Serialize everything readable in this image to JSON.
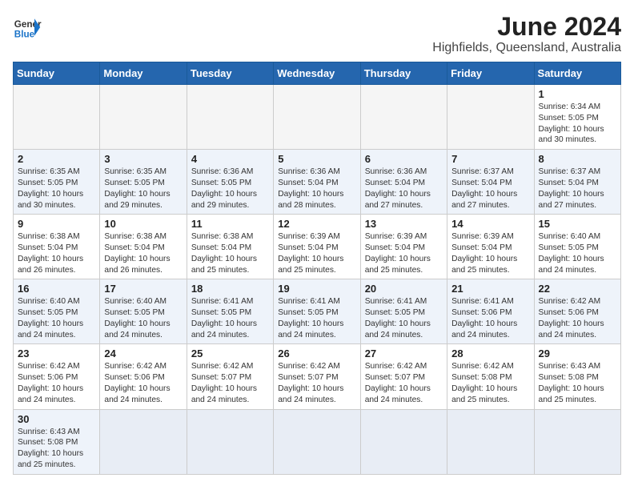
{
  "header": {
    "logo_general": "General",
    "logo_blue": "Blue",
    "month_title": "June 2024",
    "location": "Highfields, Queensland, Australia"
  },
  "weekdays": [
    "Sunday",
    "Monday",
    "Tuesday",
    "Wednesday",
    "Thursday",
    "Friday",
    "Saturday"
  ],
  "weeks": [
    [
      {
        "day": "",
        "info": "",
        "empty": true
      },
      {
        "day": "",
        "info": "",
        "empty": true
      },
      {
        "day": "",
        "info": "",
        "empty": true
      },
      {
        "day": "",
        "info": "",
        "empty": true
      },
      {
        "day": "",
        "info": "",
        "empty": true
      },
      {
        "day": "",
        "info": "",
        "empty": true
      },
      {
        "day": "1",
        "info": "Sunrise: 6:34 AM\nSunset: 5:05 PM\nDaylight: 10 hours\nand 30 minutes."
      }
    ],
    [
      {
        "day": "2",
        "info": "Sunrise: 6:35 AM\nSunset: 5:05 PM\nDaylight: 10 hours\nand 30 minutes."
      },
      {
        "day": "3",
        "info": "Sunrise: 6:35 AM\nSunset: 5:05 PM\nDaylight: 10 hours\nand 29 minutes."
      },
      {
        "day": "4",
        "info": "Sunrise: 6:36 AM\nSunset: 5:05 PM\nDaylight: 10 hours\nand 29 minutes."
      },
      {
        "day": "5",
        "info": "Sunrise: 6:36 AM\nSunset: 5:04 PM\nDaylight: 10 hours\nand 28 minutes."
      },
      {
        "day": "6",
        "info": "Sunrise: 6:36 AM\nSunset: 5:04 PM\nDaylight: 10 hours\nand 27 minutes."
      },
      {
        "day": "7",
        "info": "Sunrise: 6:37 AM\nSunset: 5:04 PM\nDaylight: 10 hours\nand 27 minutes."
      },
      {
        "day": "8",
        "info": "Sunrise: 6:37 AM\nSunset: 5:04 PM\nDaylight: 10 hours\nand 27 minutes."
      }
    ],
    [
      {
        "day": "9",
        "info": "Sunrise: 6:38 AM\nSunset: 5:04 PM\nDaylight: 10 hours\nand 26 minutes."
      },
      {
        "day": "10",
        "info": "Sunrise: 6:38 AM\nSunset: 5:04 PM\nDaylight: 10 hours\nand 26 minutes."
      },
      {
        "day": "11",
        "info": "Sunrise: 6:38 AM\nSunset: 5:04 PM\nDaylight: 10 hours\nand 25 minutes."
      },
      {
        "day": "12",
        "info": "Sunrise: 6:39 AM\nSunset: 5:04 PM\nDaylight: 10 hours\nand 25 minutes."
      },
      {
        "day": "13",
        "info": "Sunrise: 6:39 AM\nSunset: 5:04 PM\nDaylight: 10 hours\nand 25 minutes."
      },
      {
        "day": "14",
        "info": "Sunrise: 6:39 AM\nSunset: 5:04 PM\nDaylight: 10 hours\nand 25 minutes."
      },
      {
        "day": "15",
        "info": "Sunrise: 6:40 AM\nSunset: 5:05 PM\nDaylight: 10 hours\nand 24 minutes."
      }
    ],
    [
      {
        "day": "16",
        "info": "Sunrise: 6:40 AM\nSunset: 5:05 PM\nDaylight: 10 hours\nand 24 minutes."
      },
      {
        "day": "17",
        "info": "Sunrise: 6:40 AM\nSunset: 5:05 PM\nDaylight: 10 hours\nand 24 minutes."
      },
      {
        "day": "18",
        "info": "Sunrise: 6:41 AM\nSunset: 5:05 PM\nDaylight: 10 hours\nand 24 minutes."
      },
      {
        "day": "19",
        "info": "Sunrise: 6:41 AM\nSunset: 5:05 PM\nDaylight: 10 hours\nand 24 minutes."
      },
      {
        "day": "20",
        "info": "Sunrise: 6:41 AM\nSunset: 5:05 PM\nDaylight: 10 hours\nand 24 minutes."
      },
      {
        "day": "21",
        "info": "Sunrise: 6:41 AM\nSunset: 5:06 PM\nDaylight: 10 hours\nand 24 minutes."
      },
      {
        "day": "22",
        "info": "Sunrise: 6:42 AM\nSunset: 5:06 PM\nDaylight: 10 hours\nand 24 minutes."
      }
    ],
    [
      {
        "day": "23",
        "info": "Sunrise: 6:42 AM\nSunset: 5:06 PM\nDaylight: 10 hours\nand 24 minutes."
      },
      {
        "day": "24",
        "info": "Sunrise: 6:42 AM\nSunset: 5:06 PM\nDaylight: 10 hours\nand 24 minutes."
      },
      {
        "day": "25",
        "info": "Sunrise: 6:42 AM\nSunset: 5:07 PM\nDaylight: 10 hours\nand 24 minutes."
      },
      {
        "day": "26",
        "info": "Sunrise: 6:42 AM\nSunset: 5:07 PM\nDaylight: 10 hours\nand 24 minutes."
      },
      {
        "day": "27",
        "info": "Sunrise: 6:42 AM\nSunset: 5:07 PM\nDaylight: 10 hours\nand 24 minutes."
      },
      {
        "day": "28",
        "info": "Sunrise: 6:42 AM\nSunset: 5:08 PM\nDaylight: 10 hours\nand 25 minutes."
      },
      {
        "day": "29",
        "info": "Sunrise: 6:43 AM\nSunset: 5:08 PM\nDaylight: 10 hours\nand 25 minutes."
      }
    ],
    [
      {
        "day": "30",
        "info": "Sunrise: 6:43 AM\nSunset: 5:08 PM\nDaylight: 10 hours\nand 25 minutes."
      },
      {
        "day": "",
        "info": "",
        "empty": true
      },
      {
        "day": "",
        "info": "",
        "empty": true
      },
      {
        "day": "",
        "info": "",
        "empty": true
      },
      {
        "day": "",
        "info": "",
        "empty": true
      },
      {
        "day": "",
        "info": "",
        "empty": true
      },
      {
        "day": "",
        "info": "",
        "empty": true
      }
    ]
  ]
}
